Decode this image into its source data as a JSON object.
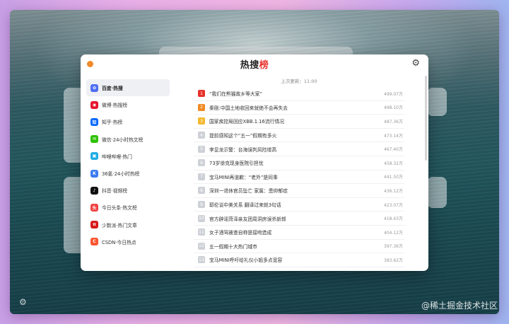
{
  "app": {
    "title_part1": "热搜",
    "title_part2": "榜",
    "updated": "上次更新：11:00",
    "settings_icon": "gear-icon"
  },
  "sidebar": {
    "items": [
      {
        "label": "百度·热搜",
        "icon": "baidu-icon",
        "color": "#4e6ef2",
        "glyph": "✿"
      },
      {
        "label": "微博·热搜榜",
        "icon": "weibo-icon",
        "color": "#e6162d",
        "glyph": "◉"
      },
      {
        "label": "知乎·热榜",
        "icon": "zhihu-icon",
        "color": "#0066ff",
        "glyph": "知"
      },
      {
        "label": "微信·24小时热文榜",
        "icon": "wechat-icon",
        "color": "#2dc100",
        "glyph": "✉"
      },
      {
        "label": "哔哩哔哩·热门",
        "icon": "bilibili-icon",
        "color": "#23ade5",
        "glyph": "▣"
      },
      {
        "label": "36氪·24小时热榜",
        "icon": "kr36-icon",
        "color": "#3b7bf2",
        "glyph": "K"
      },
      {
        "label": "抖音·视频榜",
        "icon": "douyin-icon",
        "color": "#111111",
        "glyph": "♪"
      },
      {
        "label": "今日头条·热文榜",
        "icon": "toutiao-icon",
        "color": "#f04142",
        "glyph": "头"
      },
      {
        "label": "少数派·热门文章",
        "icon": "sspai-icon",
        "color": "#d71a1b",
        "glyph": "π"
      },
      {
        "label": "CSDN·今日热点",
        "icon": "csdn-icon",
        "color": "#fc5531",
        "glyph": "C"
      }
    ]
  },
  "list": {
    "rank_colors": {
      "1": "#e6322b",
      "2": "#f08a24",
      "3": "#f5b82e",
      "rest": "#cdd0d6"
    },
    "items": [
      {
        "rank": "1",
        "title": "“我们在熊猫故乡等大家”",
        "hot": "499.07万"
      },
      {
        "rank": "2",
        "title": "秦刚:中国土地收回来就绝不会再失去",
        "hot": "498.10万"
      },
      {
        "rank": "3",
        "title": "国家疾控局回应XBB.1.16流行情况",
        "hot": "487.36万"
      },
      {
        "rank": "4",
        "title": "提前感知这个“五一”假期有多火",
        "hot": "473.14万"
      },
      {
        "rank": "5",
        "title": "李显龙示警：台海误判风险增高",
        "hot": "467.40万"
      },
      {
        "rank": "6",
        "title": "73岁徐克现身医院引担忧",
        "hot": "458.32万"
      },
      {
        "rank": "7",
        "title": "宝马MINI再道歉：“老外”是同事",
        "hot": "441.50万"
      },
      {
        "rank": "8",
        "title": "深圳一退休官员坠亡 家属：患抑郁症",
        "hot": "436.12万"
      },
      {
        "rank": "9",
        "title": "耶伦谈中美关系 翻译过来就3句话",
        "hot": "423.07万"
      },
      {
        "rank": "10",
        "title": "官方辟谣菏泽亲友团周洞房误杀新郎",
        "hot": "418.43万"
      },
      {
        "rank": "11",
        "title": "女子酒驾被查自称是接吻造成",
        "hot": "404.12万"
      },
      {
        "rank": "12",
        "title": "五一假期十大热门城市",
        "hot": "397.36万"
      },
      {
        "rank": "13",
        "title": "宝马MINI呼吁给礼仪小姐多点宽容",
        "hot": "383.62万"
      }
    ]
  },
  "watermark": "@稀土掘金技术社区"
}
